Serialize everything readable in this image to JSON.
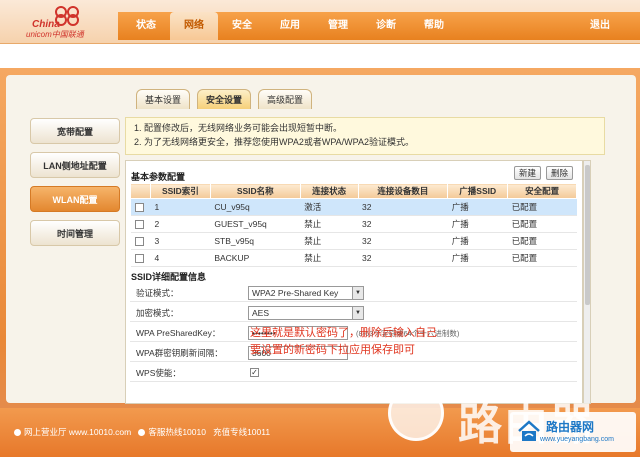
{
  "brand": {
    "china": "China",
    "unicom": "unicom中国联通"
  },
  "nav": {
    "items": [
      "状态",
      "网络",
      "安全",
      "应用",
      "管理",
      "诊断",
      "帮助"
    ],
    "active_index": 1,
    "logout": "退出"
  },
  "subtabs": {
    "items": [
      "基本设置",
      "安全设置",
      "高级配置"
    ],
    "active_index": 1
  },
  "sidebar": {
    "items": [
      "宽带配置",
      "LAN侧地址配置",
      "WLAN配置",
      "时间管理"
    ],
    "active_index": 2
  },
  "notice": {
    "line1": "1. 配置修改后，无线网络业务可能会出现短暂中断。",
    "line2": "2. 为了无线网络更安全，推荐您使用WPA2或者WPA/WPA2验证模式。"
  },
  "basic": {
    "title": "基本参数配置",
    "new_button": "新建",
    "delete_button": "删除",
    "columns": [
      "",
      "SSID索引",
      "SSID名称",
      "连接状态",
      "连接设备数目",
      "广播SSID",
      "安全配置"
    ],
    "rows": [
      {
        "index": "1",
        "name": "CU_v95q",
        "status": "激活",
        "devices": "32",
        "broadcast": "广播",
        "security": "已配置",
        "selected": true
      },
      {
        "index": "2",
        "name": "GUEST_v95q",
        "status": "禁止",
        "devices": "32",
        "broadcast": "广播",
        "security": "已配置",
        "selected": false
      },
      {
        "index": "3",
        "name": "STB_v95q",
        "status": "禁止",
        "devices": "32",
        "broadcast": "广播",
        "security": "已配置",
        "selected": false
      },
      {
        "index": "4",
        "name": "BACKUP",
        "status": "禁止",
        "devices": "32",
        "broadcast": "广播",
        "security": "已配置",
        "selected": false
      }
    ]
  },
  "detail": {
    "title": "SSID详细配置信息",
    "auth_label": "验证模式：",
    "auth_value": "WPA2 Pre-Shared Key",
    "enc_label": "加密模式：",
    "enc_value": "AES",
    "psk_label": "WPA PreSharedKey：",
    "psk_value": "••••••••",
    "psk_hint": "(8-63个字符或64个十六进制数)",
    "rekey_label": "WPA群密钥刷新间隔：",
    "rekey_value": "3600",
    "wps_label": "WPS使能：",
    "wps_checked": true
  },
  "annotation": {
    "line1": "这里就是默认密码了，删除后输入自己",
    "line2": "要设置的新密码下拉应用保存即可"
  },
  "footer": {
    "text1": "网上营业厅  www.10010.com",
    "text2": "客服热线10010",
    "text3": "充值专线10011"
  },
  "watermark": {
    "big": "路由器",
    "site_name": "路由器网",
    "site_url": "www.yueyangbang.com"
  }
}
